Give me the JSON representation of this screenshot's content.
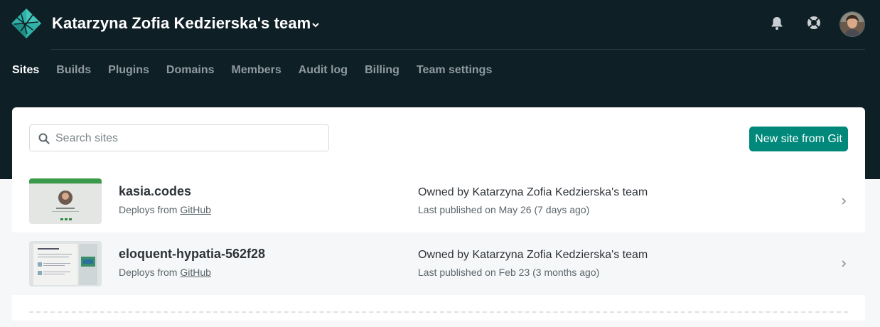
{
  "header": {
    "team_name": "Katarzyna Zofia Kedzierska's team",
    "icons": [
      "netlify-logo-icon",
      "chevron-down-icon",
      "bell-icon",
      "lifebuoy-help-icon",
      "user-avatar"
    ]
  },
  "nav": {
    "items": [
      {
        "label": "Sites",
        "active": true
      },
      {
        "label": "Builds",
        "active": false
      },
      {
        "label": "Plugins",
        "active": false
      },
      {
        "label": "Domains",
        "active": false
      },
      {
        "label": "Members",
        "active": false
      },
      {
        "label": "Audit log",
        "active": false
      },
      {
        "label": "Billing",
        "active": false
      },
      {
        "label": "Team settings",
        "active": false
      }
    ]
  },
  "toolbar": {
    "search_placeholder": "Search sites",
    "search_value": "",
    "new_site_label": "New site from Git"
  },
  "sites": [
    {
      "name": "kasia.codes",
      "deploys_prefix": "Deploys from ",
      "deploys_source": "GitHub",
      "owner": "Owned by Katarzyna Zofia Kedzierska's team",
      "published": "Last published on May 26 (7 days ago)"
    },
    {
      "name": "eloquent-hypatia-562f28",
      "deploys_prefix": "Deploys from ",
      "deploys_source": "GitHub",
      "owner": "Owned by Katarzyna Zofia Kedzierska's team",
      "published": "Last published on Feb 23 (3 months ago)"
    }
  ],
  "colors": {
    "header_bg": "#0f1f26",
    "accent_teal": "#00897b",
    "nav_inactive": "#8f9ba0",
    "nav_active": "#ffffff"
  }
}
